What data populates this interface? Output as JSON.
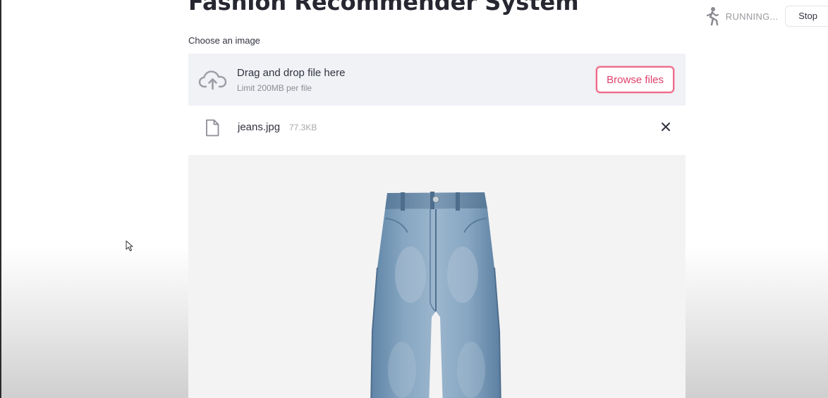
{
  "app": {
    "title": "Fashion Recommender System"
  },
  "status": {
    "running_text": "RUNNING...",
    "stop_label": "Stop",
    "icon": "running-man-icon"
  },
  "uploader": {
    "label": "Choose an image",
    "drop_text": "Drag and drop file here",
    "limit_text": "Limit 200MB per file",
    "browse_label": "Browse files",
    "upload_icon": "cloud-upload-icon"
  },
  "uploaded_file": {
    "name": "jeans.jpg",
    "size": "77.3KB",
    "file_icon": "file-icon",
    "remove_icon": "close-icon"
  },
  "preview": {
    "subject": "jeans-image"
  },
  "colors": {
    "accent": "#e0416c",
    "dropzone_bg": "#f0f2f6",
    "text": "#31333f",
    "muted": "#8c8d94"
  }
}
